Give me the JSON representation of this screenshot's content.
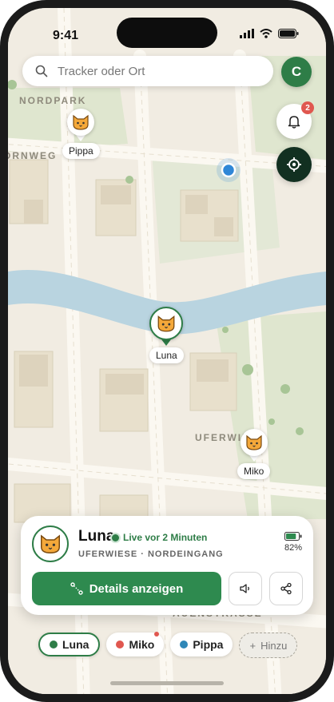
{
  "status": {
    "time": "9:41"
  },
  "search": {
    "placeholder": "Tracker oder Ort"
  },
  "profile": {
    "initial": "C"
  },
  "notifications": {
    "count": "2"
  },
  "map": {
    "area_labels": [
      "NORDPARK",
      "ORNWEG",
      "UFERWIESE",
      "AUENSTRASSE"
    ],
    "pins": [
      {
        "name": "Pippa",
        "icon": "cat-face-icon"
      },
      {
        "name": "Luna",
        "icon": "cat-face-icon",
        "active": true
      },
      {
        "name": "Miko",
        "icon": "cat-face-icon"
      }
    ]
  },
  "card": {
    "name": "Luna",
    "status": "Live vor 2 Minuten",
    "place": "UFERWIESE · NORDEINGANG",
    "battery": "82%",
    "battery_level": 0.82,
    "details_label": "Details anzeigen"
  },
  "chips": [
    {
      "label": "Luna",
      "color": "#2e7d47",
      "active": true
    },
    {
      "label": "Miko",
      "color": "#e0574f",
      "has_notification": true
    },
    {
      "label": "Pippa",
      "color": "#2f87b7"
    },
    {
      "label": "Hinzu",
      "icon": "plus-icon"
    }
  ],
  "colors": {
    "accent": "#2e7d47",
    "water": "#b9d4e0",
    "map_bg": "#f1ece2",
    "park": "#dfe6cf"
  }
}
